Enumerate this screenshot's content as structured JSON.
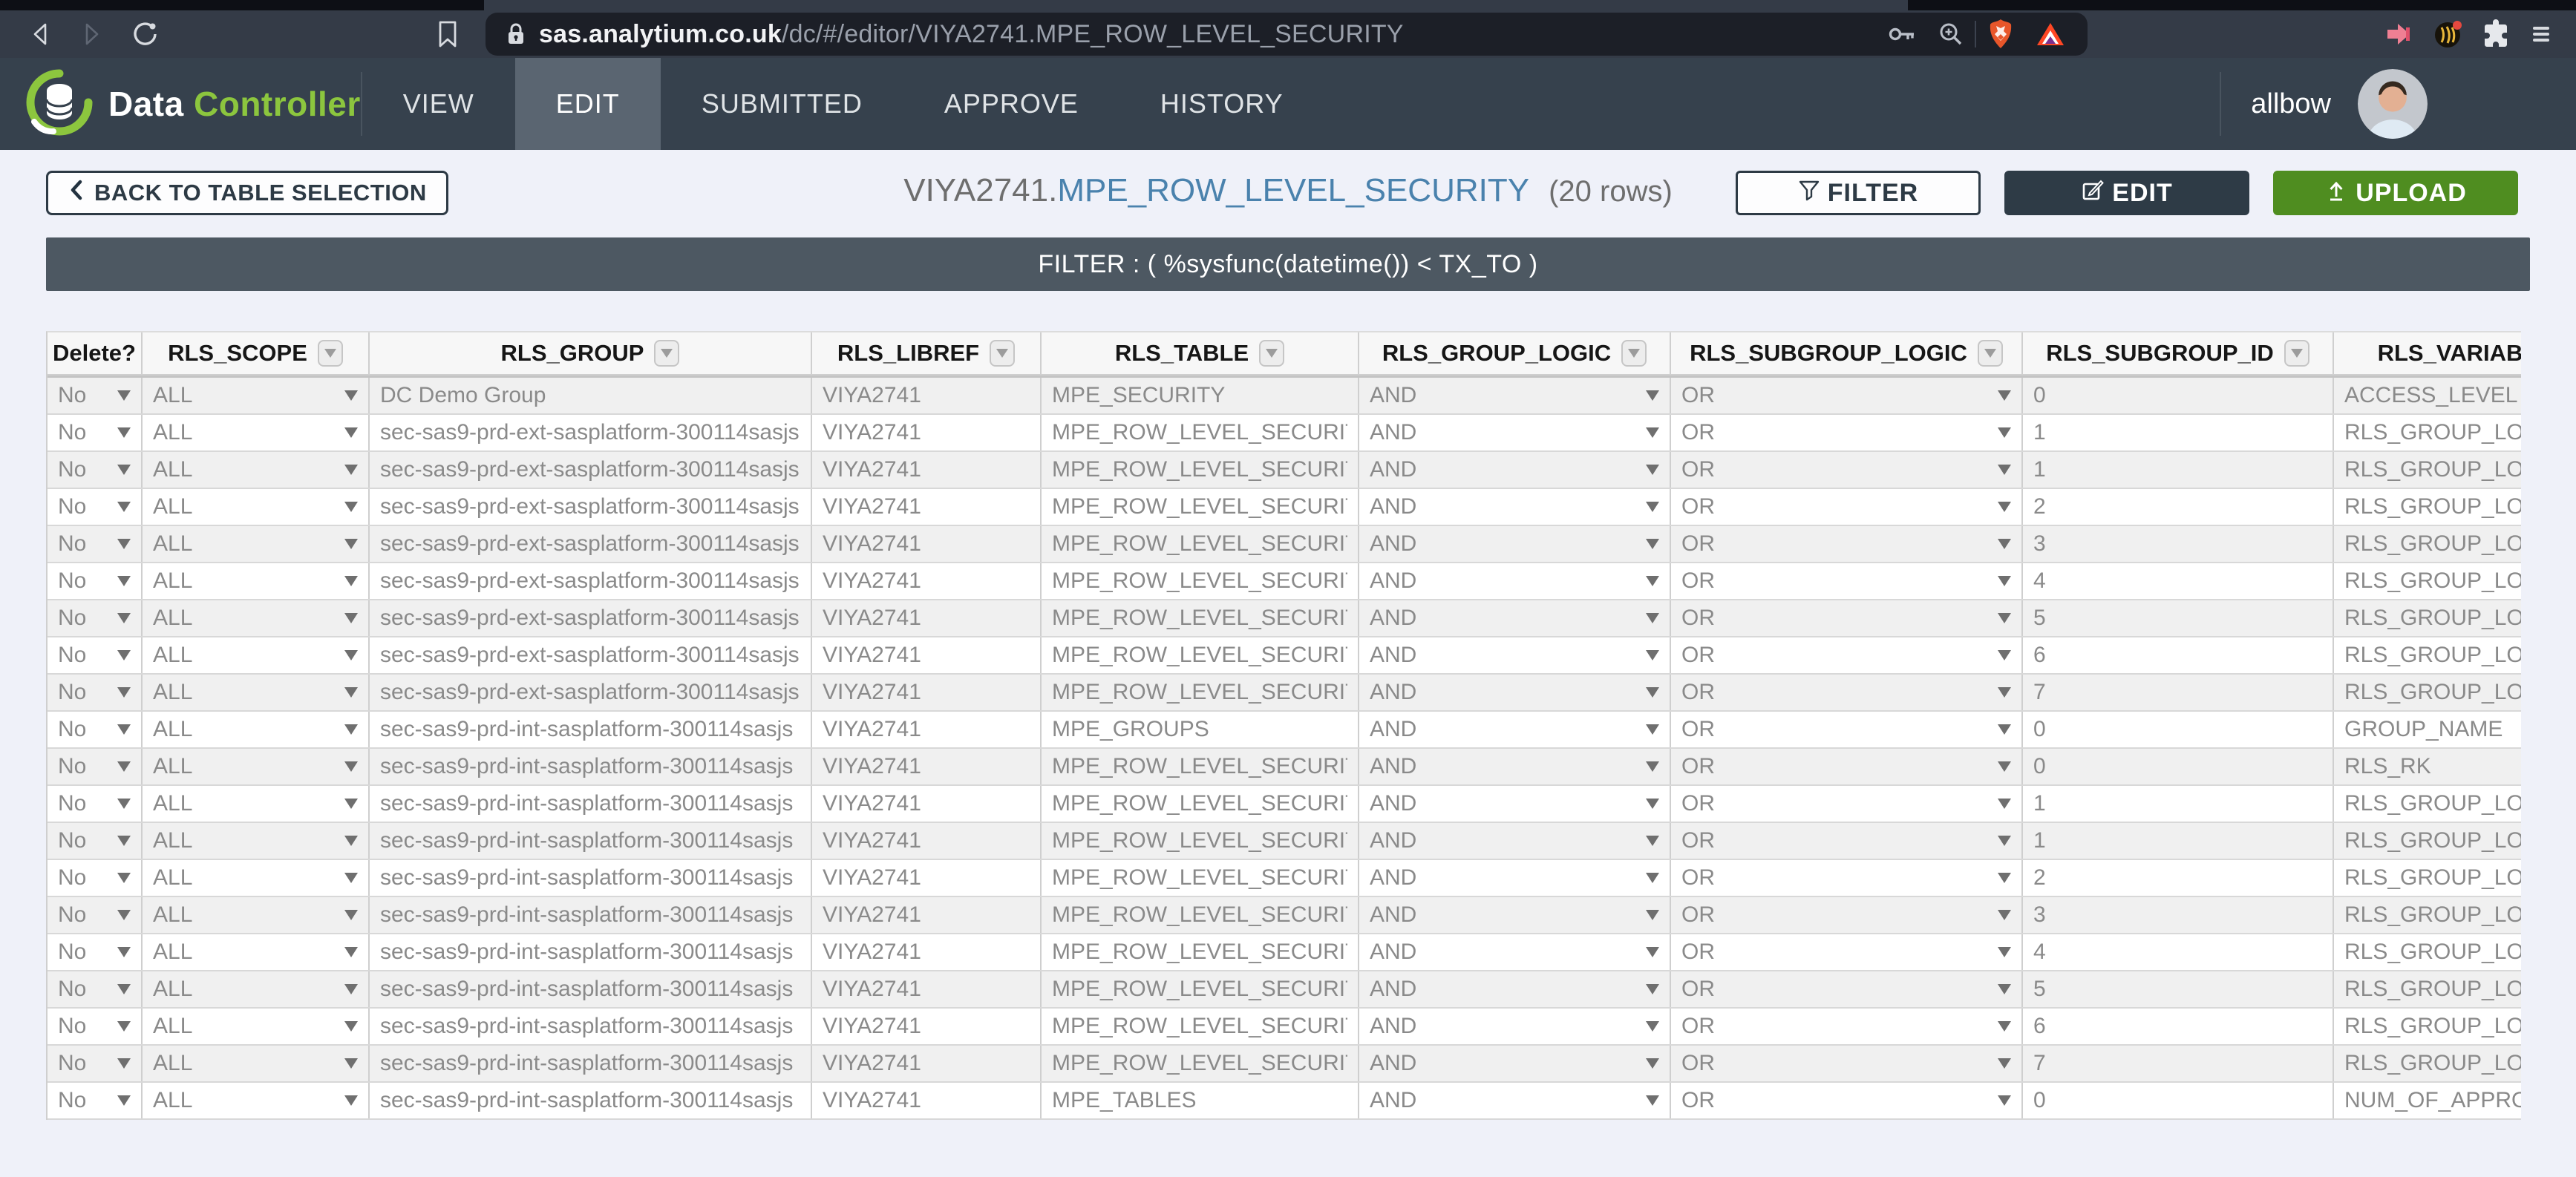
{
  "browser": {
    "url": {
      "domain": "sas.analytium.co.uk",
      "path": "/dc/#/editor/VIYA2741.MPE_ROW_LEVEL_SECURITY"
    },
    "icons": {
      "back": "chevron-left-arrow",
      "forward": "chevron-right-arrow",
      "reload": "refresh-arc",
      "bookmark": "bookmark-flag",
      "lock": "padlock",
      "key": "key",
      "zoom": "magnifier-plus",
      "brave": "brave-lion",
      "bat": "bat-triangle",
      "extension_pink": "pink-arrow",
      "extension_badge": "round-badge",
      "extensions": "puzzle-piece",
      "menu": "hamburger"
    }
  },
  "app_header": {
    "logo_word1": "Data",
    "logo_word2": "Controller",
    "nav": [
      {
        "label": "VIEW",
        "active": false
      },
      {
        "label": "EDIT",
        "active": true
      },
      {
        "label": "SUBMITTED",
        "active": false
      },
      {
        "label": "APPROVE",
        "active": false
      },
      {
        "label": "HISTORY",
        "active": false
      }
    ],
    "username": "allbow"
  },
  "toolbar": {
    "back_label": "BACK TO TABLE SELECTION",
    "title_lib": "VIYA2741.",
    "title_table": "MPE_ROW_LEVEL_SECURITY",
    "title_rows": "(20 rows)",
    "filter_label": "FILTER",
    "edit_label": "EDIT",
    "upload_label": "UPLOAD"
  },
  "filter_bar": {
    "text": "FILTER : ( %sysfunc(datetime()) < TX_TO )"
  },
  "table": {
    "columns": [
      {
        "label": "Delete?",
        "filter_icon": false,
        "cell_dropdown": true
      },
      {
        "label": "RLS_SCOPE",
        "filter_icon": true,
        "cell_dropdown": true
      },
      {
        "label": "RLS_GROUP",
        "filter_icon": true,
        "cell_dropdown": false
      },
      {
        "label": "RLS_LIBREF",
        "filter_icon": true,
        "cell_dropdown": false
      },
      {
        "label": "RLS_TABLE",
        "filter_icon": true,
        "cell_dropdown": false
      },
      {
        "label": "RLS_GROUP_LOGIC",
        "filter_icon": true,
        "cell_dropdown": true
      },
      {
        "label": "RLS_SUBGROUP_LOGIC",
        "filter_icon": true,
        "cell_dropdown": true
      },
      {
        "label": "RLS_SUBGROUP_ID",
        "filter_icon": true,
        "cell_dropdown": false
      },
      {
        "label": "RLS_VARIABLE_NM",
        "filter_icon": false,
        "cell_dropdown": false
      }
    ],
    "rows": [
      [
        "No",
        "ALL",
        "DC Demo Group",
        "VIYA2741",
        "MPE_SECURITY",
        "AND",
        "OR",
        "0",
        "ACCESS_LEVEL"
      ],
      [
        "No",
        "ALL",
        "sec-sas9-prd-ext-sasplatform-300114sasjs",
        "VIYA2741",
        "MPE_ROW_LEVEL_SECURITY",
        "AND",
        "OR",
        "1",
        "RLS_GROUP_LOGIC"
      ],
      [
        "No",
        "ALL",
        "sec-sas9-prd-ext-sasplatform-300114sasjs",
        "VIYA2741",
        "MPE_ROW_LEVEL_SECURITY",
        "AND",
        "OR",
        "1",
        "RLS_GROUP_LOGIC"
      ],
      [
        "No",
        "ALL",
        "sec-sas9-prd-ext-sasplatform-300114sasjs",
        "VIYA2741",
        "MPE_ROW_LEVEL_SECURITY",
        "AND",
        "OR",
        "2",
        "RLS_GROUP_LOGIC"
      ],
      [
        "No",
        "ALL",
        "sec-sas9-prd-ext-sasplatform-300114sasjs",
        "VIYA2741",
        "MPE_ROW_LEVEL_SECURITY",
        "AND",
        "OR",
        "3",
        "RLS_GROUP_LOGIC"
      ],
      [
        "No",
        "ALL",
        "sec-sas9-prd-ext-sasplatform-300114sasjs",
        "VIYA2741",
        "MPE_ROW_LEVEL_SECURITY",
        "AND",
        "OR",
        "4",
        "RLS_GROUP_LOGIC"
      ],
      [
        "No",
        "ALL",
        "sec-sas9-prd-ext-sasplatform-300114sasjs",
        "VIYA2741",
        "MPE_ROW_LEVEL_SECURITY",
        "AND",
        "OR",
        "5",
        "RLS_GROUP_LOGIC"
      ],
      [
        "No",
        "ALL",
        "sec-sas9-prd-ext-sasplatform-300114sasjs",
        "VIYA2741",
        "MPE_ROW_LEVEL_SECURITY",
        "AND",
        "OR",
        "6",
        "RLS_GROUP_LOGIC"
      ],
      [
        "No",
        "ALL",
        "sec-sas9-prd-ext-sasplatform-300114sasjs",
        "VIYA2741",
        "MPE_ROW_LEVEL_SECURITY",
        "AND",
        "OR",
        "7",
        "RLS_GROUP_LOGIC"
      ],
      [
        "No",
        "ALL",
        "sec-sas9-prd-int-sasplatform-300114sasjs",
        "VIYA2741",
        "MPE_GROUPS",
        "AND",
        "OR",
        "0",
        "GROUP_NAME"
      ],
      [
        "No",
        "ALL",
        "sec-sas9-prd-int-sasplatform-300114sasjs",
        "VIYA2741",
        "MPE_ROW_LEVEL_SECURITY",
        "AND",
        "OR",
        "0",
        "RLS_RK"
      ],
      [
        "No",
        "ALL",
        "sec-sas9-prd-int-sasplatform-300114sasjs",
        "VIYA2741",
        "MPE_ROW_LEVEL_SECURITY",
        "AND",
        "OR",
        "1",
        "RLS_GROUP_LOGIC"
      ],
      [
        "No",
        "ALL",
        "sec-sas9-prd-int-sasplatform-300114sasjs",
        "VIYA2741",
        "MPE_ROW_LEVEL_SECURITY",
        "AND",
        "OR",
        "1",
        "RLS_GROUP_LOGIC"
      ],
      [
        "No",
        "ALL",
        "sec-sas9-prd-int-sasplatform-300114sasjs",
        "VIYA2741",
        "MPE_ROW_LEVEL_SECURITY",
        "AND",
        "OR",
        "2",
        "RLS_GROUP_LOGIC"
      ],
      [
        "No",
        "ALL",
        "sec-sas9-prd-int-sasplatform-300114sasjs",
        "VIYA2741",
        "MPE_ROW_LEVEL_SECURITY",
        "AND",
        "OR",
        "3",
        "RLS_GROUP_LOGIC"
      ],
      [
        "No",
        "ALL",
        "sec-sas9-prd-int-sasplatform-300114sasjs",
        "VIYA2741",
        "MPE_ROW_LEVEL_SECURITY",
        "AND",
        "OR",
        "4",
        "RLS_GROUP_LOGIC"
      ],
      [
        "No",
        "ALL",
        "sec-sas9-prd-int-sasplatform-300114sasjs",
        "VIYA2741",
        "MPE_ROW_LEVEL_SECURITY",
        "AND",
        "OR",
        "5",
        "RLS_GROUP_LOGIC"
      ],
      [
        "No",
        "ALL",
        "sec-sas9-prd-int-sasplatform-300114sasjs",
        "VIYA2741",
        "MPE_ROW_LEVEL_SECURITY",
        "AND",
        "OR",
        "6",
        "RLS_GROUP_LOGIC"
      ],
      [
        "No",
        "ALL",
        "sec-sas9-prd-int-sasplatform-300114sasjs",
        "VIYA2741",
        "MPE_ROW_LEVEL_SECURITY",
        "AND",
        "OR",
        "7",
        "RLS_GROUP_LOGIC"
      ],
      [
        "No",
        "ALL",
        "sec-sas9-prd-int-sasplatform-300114sasjs",
        "VIYA2741",
        "MPE_TABLES",
        "AND",
        "OR",
        "0",
        "NUM_OF_APPROVALS"
      ]
    ]
  },
  "colors": {
    "header_bg": "#36414d",
    "active_tab_bg": "#5a6571",
    "brand_green": "#8cc63e",
    "upload_green": "#4f8d20",
    "title_blue": "#4a82ad",
    "filter_bar_bg": "#4d5862",
    "page_bg": "#eff1f9"
  }
}
